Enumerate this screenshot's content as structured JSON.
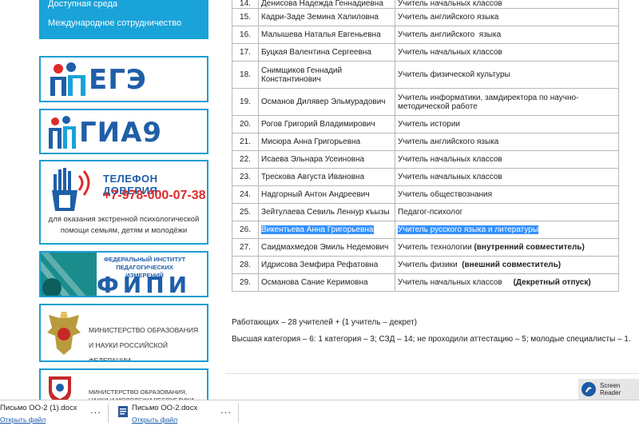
{
  "sidebar": {
    "menu": [
      "Доступная среда",
      "Международное сотрудничество"
    ],
    "banners": {
      "ege": "ЕГЭ",
      "gia": "ГИА9",
      "tel_title": "ТЕЛЕФОН ДОВЕРИЯ",
      "tel_phone": "+7-978-000-07-38",
      "tel_desc_1": "для оказания экстренной психологической",
      "tel_desc_2": "помощи семьям, детям и молодёжи",
      "fipi_small_1": "ФЕДЕРАЛЬНЫЙ ИНСТИТУТ",
      "fipi_small_2": "ПЕДАГОГИЧЕСКИХ ИЗМЕРЕНИЙ",
      "fipi_big": "ФИПИ",
      "min_1": "МИНИСТЕРСТВО ОБРАЗОВАНИЯ",
      "min_2": "И НАУКИ РОССИЙСКОЙ ФЕДЕРАЦИИ",
      "crimea_1": "МИНИСТЕРСТВО ОБРАЗОВАНИЯ,",
      "crimea_2": "НАУКИ И МОЛОДЕЖИ РЕСПУБЛИКИ КРЫМ"
    }
  },
  "table": {
    "rows": [
      {
        "num": "14.",
        "name": "Денисова Надежда Геннадиевна",
        "pos": "Учитель начальных классов"
      },
      {
        "num": "15.",
        "name": "Кадри-Заде Земина Халиловна",
        "pos": "Учитель английского языка"
      },
      {
        "num": "16.",
        "name": "Малышева Наталья Евгеньевна",
        "pos": "Учитель английского  языка"
      },
      {
        "num": "17.",
        "name": "Буцкая Валентина Сергеевна",
        "pos": "Учитель начальных классов"
      },
      {
        "num": "18.",
        "name": "Снимщиков Геннадий Константинович",
        "pos": "Учитель физической культуры"
      },
      {
        "num": "19.",
        "name": "Османов Дилявер Эльмурадович",
        "pos": "Учитель информатики, замдиректора по научно-методической работе"
      },
      {
        "num": "20.",
        "name": "Рогов Григорий Владимирович",
        "pos": "Учитель истории"
      },
      {
        "num": "21.",
        "name": "Мисюра Анна Григорьевна",
        "pos": "Учитель английского языка"
      },
      {
        "num": "22.",
        "name": "Исаева Эльнара Усеиновна",
        "pos": "Учитель начальных классов"
      },
      {
        "num": "23.",
        "name": "Трескова Августа Ивановна",
        "pos": "Учитель начальных классов"
      },
      {
        "num": "24.",
        "name": "Надгорный Антон Андреевич",
        "pos": "Учитель обществознания"
      },
      {
        "num": "25.",
        "name": "Зейтулаева Севиль  Леннур къызы",
        "pos": "Педагог-психолог"
      },
      {
        "num": "26.",
        "name": "Викентьева Анна Григорьевна",
        "pos": "Учитель русского языка и литературы"
      },
      {
        "num": "27.",
        "name": "Саидмахмедов Эмиль Недемович",
        "pos": "Учитель технологии",
        "note": "(внутренний совместитель)"
      },
      {
        "num": "28.",
        "name": "Идрисова Земфира Рефатовна",
        "pos": "Учитель физики ",
        "note": "(внешний совместитель)"
      },
      {
        "num": "29.",
        "name": "Османова Сание Керимовна",
        "pos": "Учитель начальных классов   ",
        "note": " (Декретный отпуск)"
      }
    ]
  },
  "summary": {
    "line1": "Работающих – 28 учителей +  (1 учитель – декрет)",
    "line2": "Высшая категория – 6:  1 категория – 3;  СЗД – 14;  не проходили аттестацию – 5; молодые специалисты – 1."
  },
  "screen_reader": {
    "line1": "Screen",
    "line2": "Reader"
  },
  "downloads": [
    {
      "name": "Письмо ОО-2 (1).docx",
      "action": "Открыть файл",
      "more": "..."
    },
    {
      "name": "Письмо ОО-2.docx",
      "action": "Открыть файл",
      "more": "..."
    }
  ],
  "colors": {
    "accent": "#1aa3d9",
    "brand_blue": "#1f5fa8",
    "selection": "#3390ff",
    "hotline_red": "#e02a2a"
  }
}
